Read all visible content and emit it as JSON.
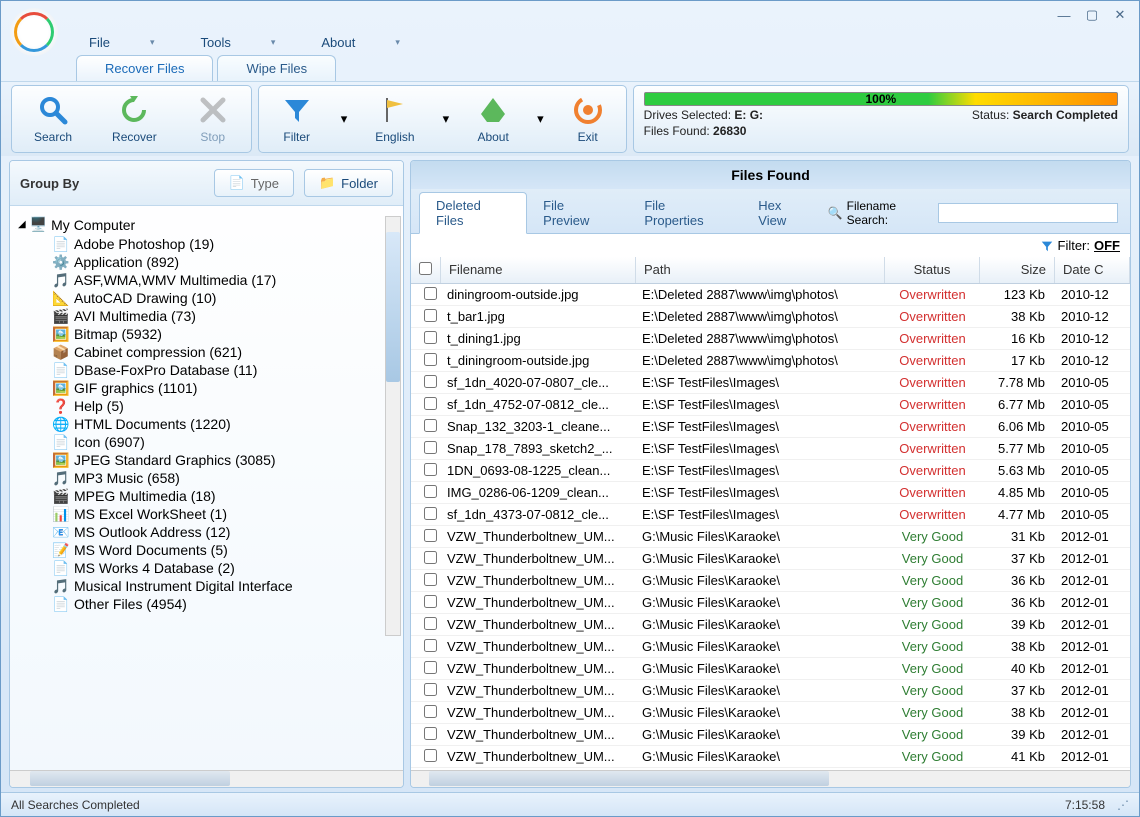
{
  "menu": {
    "file": "File",
    "tools": "Tools",
    "about": "About"
  },
  "ribbon_tabs": {
    "recover": "Recover Files",
    "wipe": "Wipe Files"
  },
  "toolbar": {
    "search": "Search",
    "recover": "Recover",
    "stop": "Stop",
    "filter": "Filter",
    "english": "English",
    "about": "About",
    "exit": "Exit"
  },
  "status": {
    "progress": "100%",
    "drives_label": "Drives Selected:",
    "drives_value": "E: G:",
    "files_found_label": "Files Found:",
    "files_found_value": "26830",
    "status_label": "Status:",
    "status_value": "Search Completed"
  },
  "groupby": {
    "label": "Group By",
    "type": "Type",
    "folder": "Folder"
  },
  "tree": {
    "root": "My Computer",
    "items": [
      "Adobe Photoshop (19)",
      "Application (892)",
      "ASF,WMA,WMV Multimedia (17)",
      "AutoCAD Drawing (10)",
      "AVI Multimedia (73)",
      "Bitmap (5932)",
      "Cabinet compression (621)",
      "DBase-FoxPro Database (11)",
      "GIF graphics (1101)",
      "Help (5)",
      "HTML Documents (1220)",
      "Icon (6907)",
      "JPEG Standard Graphics (3085)",
      "MP3 Music (658)",
      "MPEG Multimedia (18)",
      "MS Excel WorkSheet (1)",
      "MS Outlook Address (12)",
      "MS Word Documents (5)",
      "MS Works 4 Database (2)",
      "Musical Instrument Digital Interface",
      "Other Files (4954)"
    ]
  },
  "right": {
    "title": "Files Found",
    "tabs": [
      "Deleted Files",
      "File Preview",
      "File Properties",
      "Hex View"
    ],
    "search_label": "Filename Search:",
    "filter_label": "Filter:",
    "filter_state": "OFF"
  },
  "table": {
    "headers": {
      "filename": "Filename",
      "path": "Path",
      "status": "Status",
      "size": "Size",
      "date": "Date C"
    },
    "rows": [
      {
        "name": "diningroom-outside.jpg",
        "path": "E:\\Deleted 2887\\www\\img\\photos\\",
        "status": "Overwritten",
        "stype": "over",
        "size": "123 Kb",
        "date": "2010-12"
      },
      {
        "name": "t_bar1.jpg",
        "path": "E:\\Deleted 2887\\www\\img\\photos\\",
        "status": "Overwritten",
        "stype": "over",
        "size": "38 Kb",
        "date": "2010-12"
      },
      {
        "name": "t_dining1.jpg",
        "path": "E:\\Deleted 2887\\www\\img\\photos\\",
        "status": "Overwritten",
        "stype": "over",
        "size": "16 Kb",
        "date": "2010-12"
      },
      {
        "name": "t_diningroom-outside.jpg",
        "path": "E:\\Deleted 2887\\www\\img\\photos\\",
        "status": "Overwritten",
        "stype": "over",
        "size": "17 Kb",
        "date": "2010-12"
      },
      {
        "name": "sf_1dn_4020-07-0807_cle...",
        "path": "E:\\SF TestFiles\\Images\\",
        "status": "Overwritten",
        "stype": "over",
        "size": "7.78 Mb",
        "date": "2010-05"
      },
      {
        "name": "sf_1dn_4752-07-0812_cle...",
        "path": "E:\\SF TestFiles\\Images\\",
        "status": "Overwritten",
        "stype": "over",
        "size": "6.77 Mb",
        "date": "2010-05"
      },
      {
        "name": "Snap_132_3203-1_cleane...",
        "path": "E:\\SF TestFiles\\Images\\",
        "status": "Overwritten",
        "stype": "over",
        "size": "6.06 Mb",
        "date": "2010-05"
      },
      {
        "name": "Snap_178_7893_sketch2_...",
        "path": "E:\\SF TestFiles\\Images\\",
        "status": "Overwritten",
        "stype": "over",
        "size": "5.77 Mb",
        "date": "2010-05"
      },
      {
        "name": "1DN_0693-08-1225_clean...",
        "path": "E:\\SF TestFiles\\Images\\",
        "status": "Overwritten",
        "stype": "over",
        "size": "5.63 Mb",
        "date": "2010-05"
      },
      {
        "name": "IMG_0286-06-1209_clean...",
        "path": "E:\\SF TestFiles\\Images\\",
        "status": "Overwritten",
        "stype": "over",
        "size": "4.85 Mb",
        "date": "2010-05"
      },
      {
        "name": "sf_1dn_4373-07-0812_cle...",
        "path": "E:\\SF TestFiles\\Images\\",
        "status": "Overwritten",
        "stype": "over",
        "size": "4.77 Mb",
        "date": "2010-05"
      },
      {
        "name": "VZW_Thunderboltnew_UM...",
        "path": "G:\\Music Files\\Karaoke\\",
        "status": "Very Good",
        "stype": "good",
        "size": "31 Kb",
        "date": "2012-01"
      },
      {
        "name": "VZW_Thunderboltnew_UM...",
        "path": "G:\\Music Files\\Karaoke\\",
        "status": "Very Good",
        "stype": "good",
        "size": "37 Kb",
        "date": "2012-01"
      },
      {
        "name": "VZW_Thunderboltnew_UM...",
        "path": "G:\\Music Files\\Karaoke\\",
        "status": "Very Good",
        "stype": "good",
        "size": "36 Kb",
        "date": "2012-01"
      },
      {
        "name": "VZW_Thunderboltnew_UM...",
        "path": "G:\\Music Files\\Karaoke\\",
        "status": "Very Good",
        "stype": "good",
        "size": "36 Kb",
        "date": "2012-01"
      },
      {
        "name": "VZW_Thunderboltnew_UM...",
        "path": "G:\\Music Files\\Karaoke\\",
        "status": "Very Good",
        "stype": "good",
        "size": "39 Kb",
        "date": "2012-01"
      },
      {
        "name": "VZW_Thunderboltnew_UM...",
        "path": "G:\\Music Files\\Karaoke\\",
        "status": "Very Good",
        "stype": "good",
        "size": "38 Kb",
        "date": "2012-01"
      },
      {
        "name": "VZW_Thunderboltnew_UM...",
        "path": "G:\\Music Files\\Karaoke\\",
        "status": "Very Good",
        "stype": "good",
        "size": "40 Kb",
        "date": "2012-01"
      },
      {
        "name": "VZW_Thunderboltnew_UM...",
        "path": "G:\\Music Files\\Karaoke\\",
        "status": "Very Good",
        "stype": "good",
        "size": "37 Kb",
        "date": "2012-01"
      },
      {
        "name": "VZW_Thunderboltnew_UM...",
        "path": "G:\\Music Files\\Karaoke\\",
        "status": "Very Good",
        "stype": "good",
        "size": "38 Kb",
        "date": "2012-01"
      },
      {
        "name": "VZW_Thunderboltnew_UM...",
        "path": "G:\\Music Files\\Karaoke\\",
        "status": "Very Good",
        "stype": "good",
        "size": "39 Kb",
        "date": "2012-01"
      },
      {
        "name": "VZW_Thunderboltnew_UM...",
        "path": "G:\\Music Files\\Karaoke\\",
        "status": "Very Good",
        "stype": "good",
        "size": "41 Kb",
        "date": "2012-01"
      }
    ]
  },
  "statusbar": {
    "text": "All Searches Completed",
    "time": "7:15:58"
  }
}
